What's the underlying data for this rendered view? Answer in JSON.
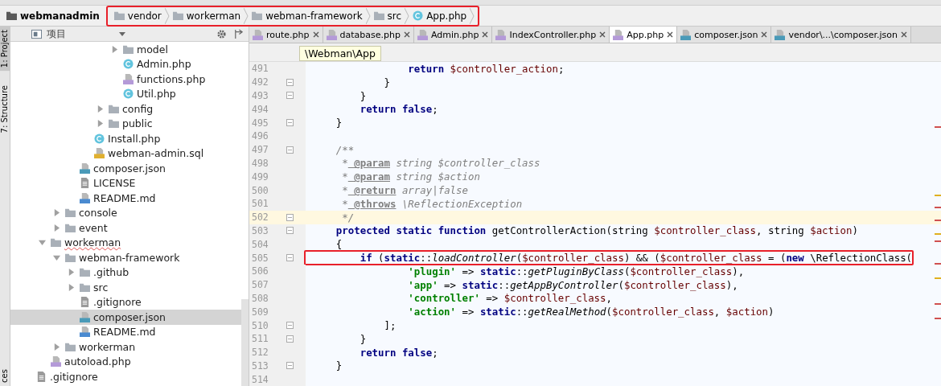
{
  "breadcrumb": {
    "project": "webmanadmin",
    "highlighted": true,
    "items": [
      {
        "label": "vendor",
        "kind": "folder"
      },
      {
        "label": "workerman",
        "kind": "folder"
      },
      {
        "label": "webman-framework",
        "kind": "folder"
      },
      {
        "label": "src",
        "kind": "folder"
      },
      {
        "label": "App.php",
        "kind": "class"
      }
    ]
  },
  "side_tabs": [
    {
      "label": "1: Project",
      "selected": true
    },
    {
      "label": "7: Structure",
      "selected": false
    },
    {
      "label": "ces",
      "selected": false
    }
  ],
  "project_panel": {
    "title": "项目",
    "tree": [
      {
        "children": [
          {
            "children": [
              {
                "children": [
                  {
                    "children": [
                      {
                        "children": [
                          {
                            "children": [
                              {
                                "children": [
                                  {
                                    "label": "model",
                                    "kind": "folder",
                                    "expanded": false
                                  },
                                  {
                                    "label": "Admin.php",
                                    "kind": "class"
                                  },
                                  {
                                    "label": "functions.php",
                                    "kind": "php"
                                  },
                                  {
                                    "label": "Util.php",
                                    "kind": "class"
                                  }
                                ]
                              },
                              {
                                "label": "config",
                                "kind": "folder",
                                "expanded": false
                              },
                              {
                                "label": "public",
                                "kind": "folder",
                                "expanded": false
                              }
                            ]
                          },
                          {
                            "label": "Install.php",
                            "kind": "class"
                          },
                          {
                            "label": "webman-admin.sql",
                            "kind": "sql"
                          }
                        ]
                      },
                      {
                        "label": "composer.json",
                        "kind": "json"
                      },
                      {
                        "label": "LICENSE",
                        "kind": "text"
                      },
                      {
                        "label": "README.md",
                        "kind": "md"
                      }
                    ]
                  },
                  {
                    "label": "console",
                    "kind": "folder",
                    "expanded": false
                  },
                  {
                    "label": "event",
                    "kind": "folder",
                    "expanded": false
                  }
                ]
              },
              {
                "label": "workerman",
                "kind": "folder",
                "expanded": true,
                "children": [
                  {
                    "label": "webman-framework",
                    "kind": "folder",
                    "expanded": true,
                    "children": [
                      {
                        "label": ".github",
                        "kind": "folder",
                        "expanded": false
                      },
                      {
                        "label": "src",
                        "kind": "folder",
                        "expanded": false
                      },
                      {
                        "label": ".gitignore",
                        "kind": "text"
                      },
                      {
                        "label": "composer.json",
                        "kind": "json",
                        "selected": true
                      },
                      {
                        "label": "README.md",
                        "kind": "md"
                      }
                    ]
                  },
                  {
                    "label": "workerman",
                    "kind": "folder",
                    "expanded": false
                  }
                ]
              },
              {
                "label": "autoload.php",
                "kind": "php"
              }
            ]
          },
          {
            "label": ".gitignore",
            "kind": "text"
          }
        ]
      }
    ]
  },
  "editor": {
    "tabs": [
      {
        "label": "route.php",
        "kind": "php",
        "selected": false
      },
      {
        "label": "database.php",
        "kind": "php",
        "selected": false
      },
      {
        "label": "Admin.php",
        "kind": "php",
        "selected": false
      },
      {
        "label": "IndexController.php",
        "kind": "php",
        "selected": false
      },
      {
        "label": "App.php",
        "kind": "php",
        "selected": true
      },
      {
        "label": "composer.json",
        "kind": "json",
        "selected": false
      },
      {
        "label": "vendor\\...\\composer.json",
        "kind": "json",
        "selected": false
      }
    ],
    "scope_hint": "\\Webman\\App",
    "lines": [
      {
        "number": "491",
        "segs": [
          {
            "kind": "keyword",
            "text": "                return"
          },
          {
            "kind": "variable",
            "text": " $controller_action"
          },
          {
            "kind": "plain",
            "text": ";"
          }
        ]
      },
      {
        "number": "492",
        "fold": true,
        "segs": [
          {
            "kind": "plain",
            "text": "            }"
          }
        ]
      },
      {
        "number": "493",
        "fold": true,
        "segs": [
          {
            "kind": "plain",
            "text": "        }"
          }
        ]
      },
      {
        "number": "494",
        "segs": [
          {
            "kind": "keyword",
            "text": "        return false"
          },
          {
            "kind": "plain",
            "text": ";"
          }
        ]
      },
      {
        "number": "495",
        "fold": true,
        "segs": [
          {
            "kind": "plain",
            "text": "    }"
          }
        ]
      },
      {
        "number": "496"
      },
      {
        "number": "497",
        "fold": true,
        "segs": [
          {
            "kind": "comment",
            "text": "    /**"
          }
        ]
      },
      {
        "number": "498",
        "segs": [
          {
            "kind": "comment",
            "text": "     *"
          },
          {
            "kind": "doctag",
            "text": " @param"
          },
          {
            "kind": "comment",
            "text": " string $controller_class"
          }
        ]
      },
      {
        "number": "499",
        "segs": [
          {
            "kind": "comment",
            "text": "     *"
          },
          {
            "kind": "doctag",
            "text": " @param"
          },
          {
            "kind": "comment",
            "text": " string $action"
          }
        ]
      },
      {
        "number": "500",
        "segs": [
          {
            "kind": "comment",
            "text": "     *"
          },
          {
            "kind": "doctag",
            "text": " @return"
          },
          {
            "kind": "comment",
            "text": " array|false"
          }
        ]
      },
      {
        "number": "501",
        "segs": [
          {
            "kind": "comment",
            "text": "     *"
          },
          {
            "kind": "doctag",
            "text": " @throws"
          },
          {
            "kind": "comment",
            "text": " \\ReflectionException"
          }
        ]
      },
      {
        "number": "502",
        "fold": true,
        "current": true,
        "segs": [
          {
            "kind": "comment",
            "text": "     */"
          }
        ]
      },
      {
        "number": "503",
        "fold": true,
        "segs": [
          {
            "kind": "keyword",
            "text": "    protected static function"
          },
          {
            "kind": "plain",
            "text": " getControllerAction(string"
          },
          {
            "kind": "variable",
            "text": " $controller_class"
          },
          {
            "kind": "plain",
            "text": ", string"
          },
          {
            "kind": "variable",
            "text": " $action"
          },
          {
            "kind": "plain",
            "text": ")"
          }
        ]
      },
      {
        "number": "504",
        "segs": [
          {
            "kind": "plain",
            "text": "    {"
          }
        ]
      },
      {
        "number": "505",
        "fold": true,
        "highlighted": true,
        "segs": [
          {
            "kind": "keyword",
            "text": "        if"
          },
          {
            "kind": "plain",
            "text": " ("
          },
          {
            "kind": "keyword",
            "text": "static"
          },
          {
            "kind": "plain",
            "text": "::"
          },
          {
            "kind": "call",
            "text": "loadController"
          },
          {
            "kind": "plain",
            "text": "("
          },
          {
            "kind": "variable",
            "text": "$controller_class"
          },
          {
            "kind": "plain",
            "text": ") && ("
          },
          {
            "kind": "variable",
            "text": "$controller_class"
          },
          {
            "kind": "plain",
            "text": " = ("
          },
          {
            "kind": "keyword",
            "text": "new"
          },
          {
            "kind": "plain",
            "text": " \\ReflectionClass("
          }
        ]
      },
      {
        "number": "506",
        "segs": [
          {
            "kind": "string",
            "text": "                'plugin'"
          },
          {
            "kind": "plain",
            "text": " =>"
          },
          {
            "kind": "keyword",
            "text": " static"
          },
          {
            "kind": "plain",
            "text": "::"
          },
          {
            "kind": "call",
            "text": "getPluginByClass"
          },
          {
            "kind": "plain",
            "text": "("
          },
          {
            "kind": "variable",
            "text": "$controller_class"
          },
          {
            "kind": "plain",
            "text": "),"
          }
        ]
      },
      {
        "number": "507",
        "segs": [
          {
            "kind": "string",
            "text": "                'app'"
          },
          {
            "kind": "plain",
            "text": " =>"
          },
          {
            "kind": "keyword",
            "text": " static"
          },
          {
            "kind": "plain",
            "text": "::"
          },
          {
            "kind": "call",
            "text": "getAppByController"
          },
          {
            "kind": "plain",
            "text": "("
          },
          {
            "kind": "variable",
            "text": "$controller_class"
          },
          {
            "kind": "plain",
            "text": "),"
          }
        ]
      },
      {
        "number": "508",
        "segs": [
          {
            "kind": "string",
            "text": "                'controller'"
          },
          {
            "kind": "plain",
            "text": " =>"
          },
          {
            "kind": "variable",
            "text": " $controller_class"
          },
          {
            "kind": "plain",
            "text": ","
          }
        ]
      },
      {
        "number": "509",
        "segs": [
          {
            "kind": "string",
            "text": "                'action'"
          },
          {
            "kind": "plain",
            "text": " =>"
          },
          {
            "kind": "keyword",
            "text": " static"
          },
          {
            "kind": "plain",
            "text": "::"
          },
          {
            "kind": "call",
            "text": "getRealMethod"
          },
          {
            "kind": "plain",
            "text": "("
          },
          {
            "kind": "variable",
            "text": "$controller_class"
          },
          {
            "kind": "plain",
            "text": ","
          },
          {
            "kind": "variable",
            "text": " $action"
          },
          {
            "kind": "plain",
            "text": ")"
          }
        ]
      },
      {
        "number": "510",
        "fold": true,
        "segs": [
          {
            "kind": "plain",
            "text": "            ];"
          }
        ]
      },
      {
        "number": "511",
        "fold": true,
        "segs": [
          {
            "kind": "plain",
            "text": "        }"
          }
        ]
      },
      {
        "number": "512",
        "segs": [
          {
            "kind": "keyword",
            "text": "        return false"
          },
          {
            "kind": "plain",
            "text": ";"
          }
        ]
      },
      {
        "number": "513",
        "fold": true,
        "segs": [
          {
            "kind": "plain",
            "text": "    }"
          }
        ]
      },
      {
        "number": "514"
      }
    ]
  }
}
